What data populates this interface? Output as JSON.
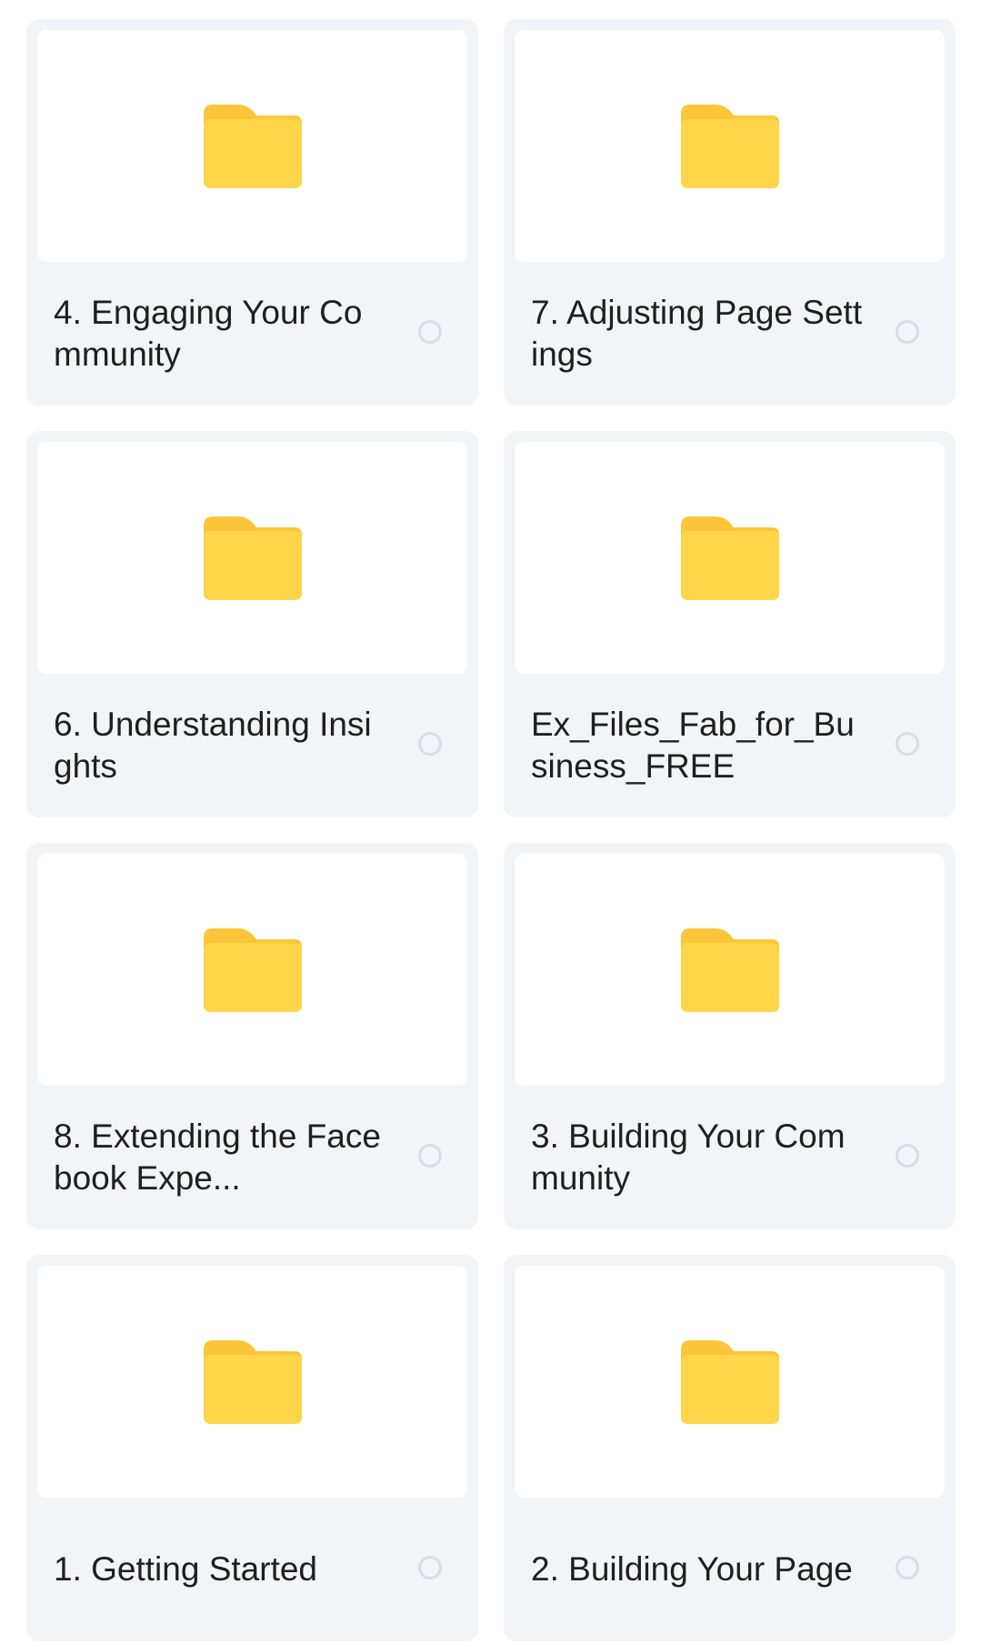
{
  "colors": {
    "card_background": "#f3f4f8",
    "thumbnail_background": "#ffffff",
    "folder_body": "#ffd64a",
    "folder_tab": "#fcc63a",
    "radio_border": "#dcdde2",
    "text": "#1f1f1f"
  },
  "icon": "folder-icon",
  "folders": [
    {
      "name": "4. Engaging Your Community",
      "selected": false
    },
    {
      "name": "7. Adjusting Page Settings",
      "selected": false
    },
    {
      "name": "6. Understanding Insights",
      "selected": false
    },
    {
      "name": "Ex_Files_Fab_for_Business_FREE",
      "selected": false
    },
    {
      "name": "8. Extending the Facebook Expe...",
      "selected": false
    },
    {
      "name": "3. Building Your Community",
      "selected": false
    },
    {
      "name": "1. Getting Started",
      "selected": false
    },
    {
      "name": "2. Building Your Page",
      "selected": false
    }
  ]
}
